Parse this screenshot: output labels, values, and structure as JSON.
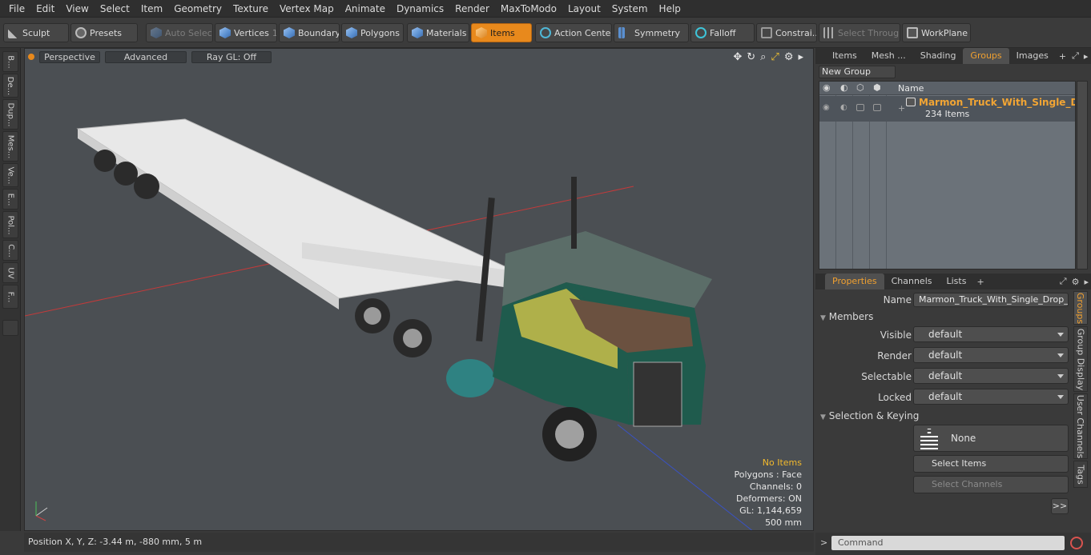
{
  "menubar": [
    "File",
    "Edit",
    "View",
    "Select",
    "Item",
    "Geometry",
    "Texture",
    "Vertex Map",
    "Animate",
    "Dynamics",
    "Render",
    "MaxToModo",
    "Layout",
    "System",
    "Help"
  ],
  "toolbar": {
    "sculpt": "Sculpt",
    "presets": "Presets",
    "auto_select": "Auto Select",
    "vertices": "Vertices",
    "vertices_count": "1",
    "boundary": "Boundary",
    "polygons": "Polygons",
    "materials": "Materials",
    "items": "Items",
    "action_center": "Action Center",
    "symmetry": "Symmetry",
    "falloff": "Falloff",
    "constraints": "Constrai...",
    "select_through": "Select Through",
    "workplane": "WorkPlane"
  },
  "left_tabs": [
    "B...",
    "De...",
    "Dup...",
    "Mes...",
    "Ve...",
    "E...",
    "Pol...",
    "C...",
    "UV",
    "F..."
  ],
  "viewport": {
    "view": "Perspective",
    "shading": "Advanced",
    "raygl": "Ray GL: Off",
    "stats": {
      "selection": "No Items",
      "polygons": "Polygons : Face",
      "channels": "Channels: 0",
      "deformers": "Deformers: ON",
      "gl": "GL: 1,144,659",
      "scale": "500 mm"
    }
  },
  "statusbar": {
    "position": "Position X, Y, Z:   -3.44 m, -880 mm, 5 m"
  },
  "top_panel": {
    "tabs": [
      "Items",
      "Mesh ...",
      "Shading",
      "Groups",
      "Images"
    ],
    "active_tab": "Groups",
    "new_group": "New Group",
    "name_header": "Name",
    "group": {
      "name": "Marmon_Truck_With_Single_Dr ...",
      "count": "234 Items"
    }
  },
  "bottom_panel": {
    "tabs": [
      "Properties",
      "Channels",
      "Lists"
    ],
    "active_tab": "Properties",
    "name_label": "Name",
    "name_value": "Marmon_Truck_With_Single_Drop_Tri_",
    "members_section": "Members",
    "visible_label": "Visible",
    "render_label": "Render",
    "selectable_label": "Selectable",
    "locked_label": "Locked",
    "visible_value": "default",
    "render_value": "default",
    "selectable_value": "default",
    "locked_value": "default",
    "selection_section": "Selection & Keying",
    "none_label": "None",
    "select_items": "Select Items",
    "select_channels": "Select Channels",
    "more": ">>",
    "side_tabs": [
      "Groups",
      "Group Display",
      "User Channels",
      "Tags"
    ]
  },
  "command": {
    "placeholder": "Command"
  },
  "colors": {
    "accent": "#e8891c",
    "background": "#3a3a3a",
    "viewport": "#4b4f53"
  }
}
